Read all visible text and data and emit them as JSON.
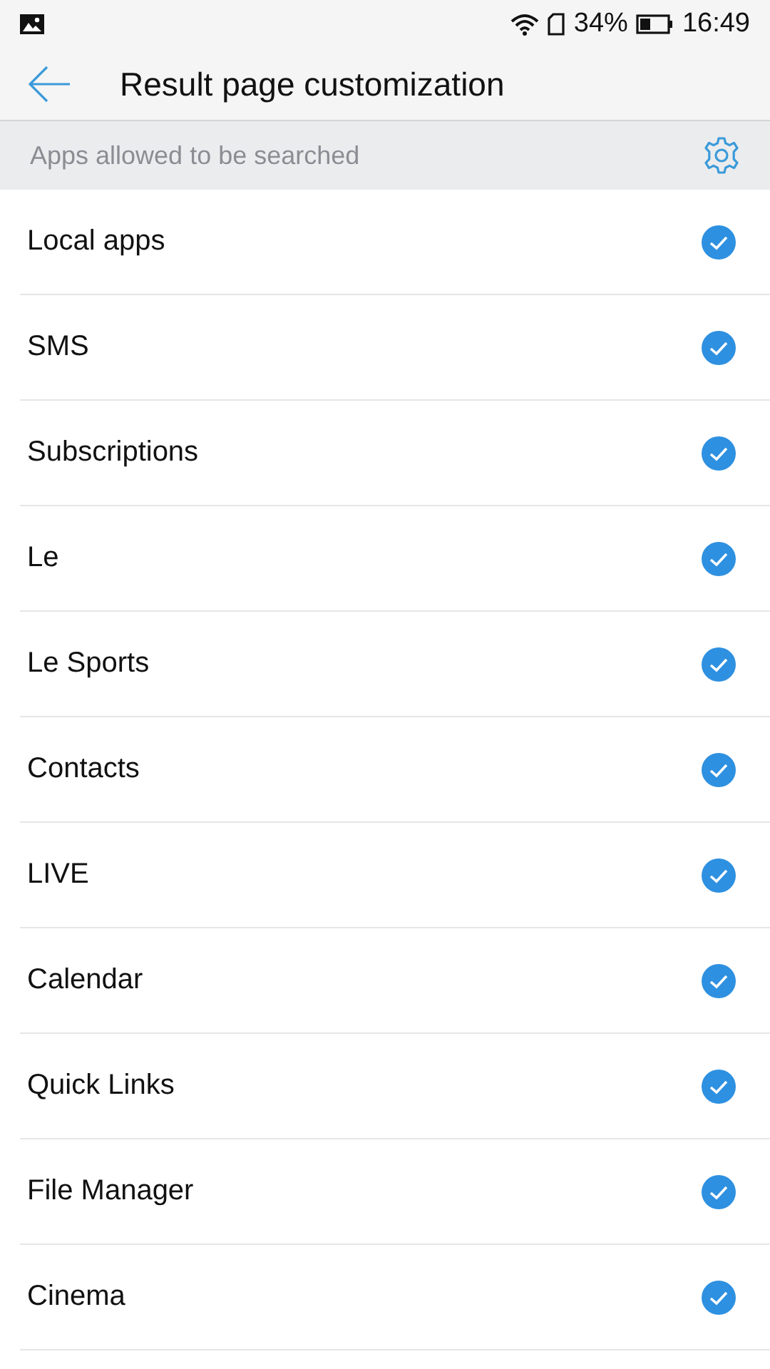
{
  "status_bar": {
    "battery": "34%",
    "time": "16:49"
  },
  "header": {
    "title": "Result page customization"
  },
  "section": {
    "title": "Apps allowed to be searched"
  },
  "apps": [
    {
      "label": "Local apps",
      "checked": true
    },
    {
      "label": "SMS",
      "checked": true
    },
    {
      "label": "Subscriptions",
      "checked": true
    },
    {
      "label": "Le",
      "checked": true
    },
    {
      "label": "Le Sports",
      "checked": true
    },
    {
      "label": "Contacts",
      "checked": true
    },
    {
      "label": "LIVE",
      "checked": true
    },
    {
      "label": "Calendar",
      "checked": true
    },
    {
      "label": "Quick Links",
      "checked": true
    },
    {
      "label": "File Manager",
      "checked": true
    },
    {
      "label": "Cinema",
      "checked": true
    }
  ]
}
